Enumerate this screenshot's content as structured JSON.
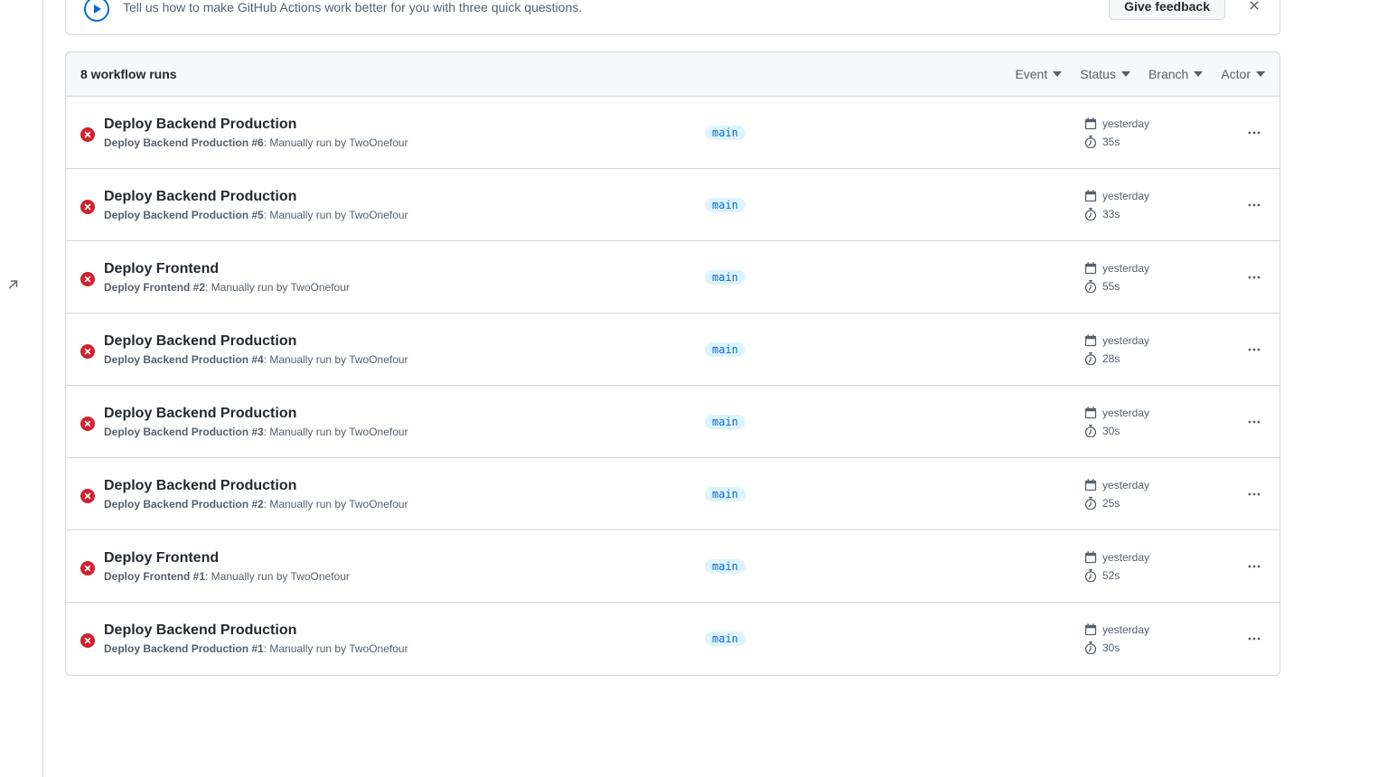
{
  "banner": {
    "subtitle": "Tell us how to make GitHub Actions work better for you with three quick questions.",
    "cta": "Give feedback"
  },
  "header": {
    "count_text": "8 workflow runs",
    "filters": [
      "Event",
      "Status",
      "Branch",
      "Actor"
    ]
  },
  "runs": [
    {
      "title": "Deploy Backend Production",
      "sub_bold": "Deploy Backend Production #6",
      "sub_rest": ": Manually run by TwoOnefour",
      "branch": "main",
      "when": "yesterday",
      "duration": "35s"
    },
    {
      "title": "Deploy Backend Production",
      "sub_bold": "Deploy Backend Production #5",
      "sub_rest": ": Manually run by TwoOnefour",
      "branch": "main",
      "when": "yesterday",
      "duration": "33s"
    },
    {
      "title": "Deploy Frontend",
      "sub_bold": "Deploy Frontend #2",
      "sub_rest": ": Manually run by TwoOnefour",
      "branch": "main",
      "when": "yesterday",
      "duration": "55s"
    },
    {
      "title": "Deploy Backend Production",
      "sub_bold": "Deploy Backend Production #4",
      "sub_rest": ": Manually run by TwoOnefour",
      "branch": "main",
      "when": "yesterday",
      "duration": "28s"
    },
    {
      "title": "Deploy Backend Production",
      "sub_bold": "Deploy Backend Production #3",
      "sub_rest": ": Manually run by TwoOnefour",
      "branch": "main",
      "when": "yesterday",
      "duration": "30s"
    },
    {
      "title": "Deploy Backend Production",
      "sub_bold": "Deploy Backend Production #2",
      "sub_rest": ": Manually run by TwoOnefour",
      "branch": "main",
      "when": "yesterday",
      "duration": "25s"
    },
    {
      "title": "Deploy Frontend",
      "sub_bold": "Deploy Frontend #1",
      "sub_rest": ": Manually run by TwoOnefour",
      "branch": "main",
      "when": "yesterday",
      "duration": "52s"
    },
    {
      "title": "Deploy Backend Production",
      "sub_bold": "Deploy Backend Production #1",
      "sub_rest": ": Manually run by TwoOnefour",
      "branch": "main",
      "when": "yesterday",
      "duration": "30s"
    }
  ]
}
